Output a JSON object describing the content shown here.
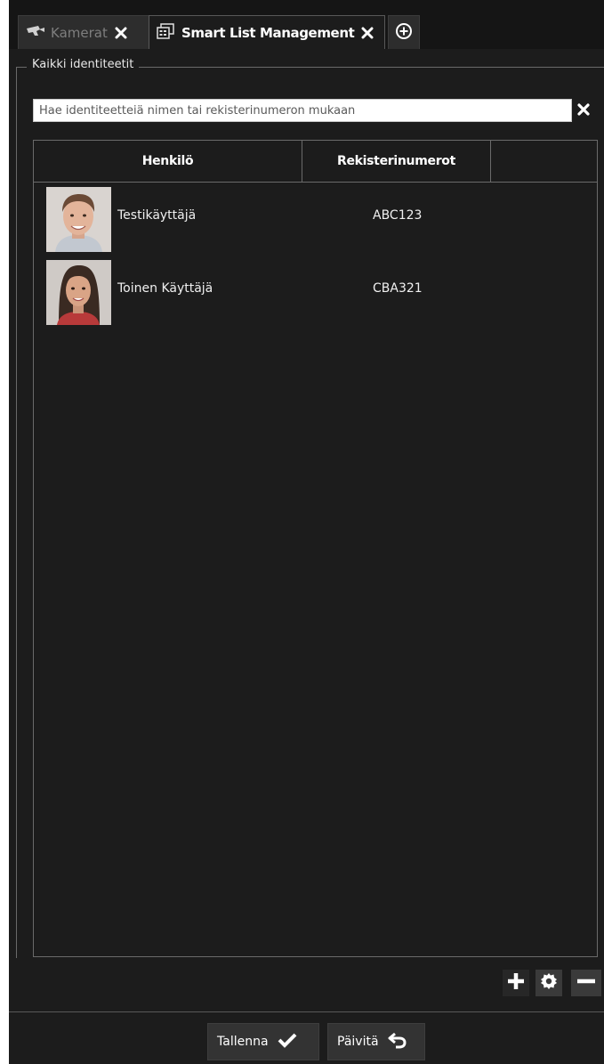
{
  "tabs": [
    {
      "label": "Kamerat",
      "icon": "camera-icon",
      "active": false
    },
    {
      "label": "Smart List Management",
      "icon": "smart-list-icon",
      "active": true
    }
  ],
  "add_tab_icon": "plus-circle-icon",
  "group": {
    "title": "Kaikki identiteetit"
  },
  "search": {
    "placeholder": "Hae identiteetteiä nimen tai rekisterinumeron mukaan",
    "value": ""
  },
  "table": {
    "headers": {
      "person": "Henkilö",
      "plates": "Rekisterinumerot",
      "extra": ""
    },
    "rows": [
      {
        "name": "Testikäyttäjä",
        "plate": "ABC123"
      },
      {
        "name": "Toinen Käyttäjä",
        "plate": "CBA321"
      }
    ]
  },
  "actions": {
    "add": "plus-icon",
    "settings": "gear-icon",
    "remove": "minus-icon"
  },
  "footer": {
    "save_label": "Tallenna",
    "refresh_label": "Päivitä"
  },
  "colors": {
    "background": "#1c1c1c",
    "tabbar": "#151515",
    "border": "#6a6a6a"
  }
}
